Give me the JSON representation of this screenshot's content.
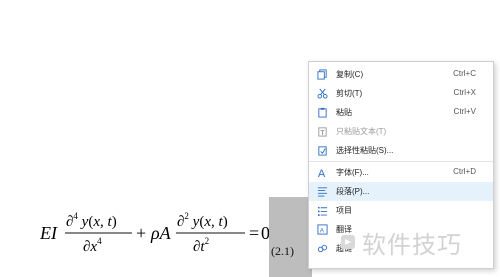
{
  "equation": {
    "lhs_text": "EI ∂⁴y(x,t)/∂x⁴ + ρA ∂²y(x,t)/∂t² = 0",
    "number": "(2.1)"
  },
  "context_menu": {
    "items": [
      {
        "label": "复制(C)",
        "shortcut": "Ctrl+C",
        "icon": "copy-icon",
        "enabled": true
      },
      {
        "label": "剪切(T)",
        "shortcut": "Ctrl+X",
        "icon": "cut-icon",
        "enabled": true
      },
      {
        "label": "粘贴",
        "shortcut": "Ctrl+V",
        "icon": "paste-icon",
        "enabled": true
      },
      {
        "label": "只粘贴文本(T)",
        "shortcut": "",
        "icon": "paste-text-icon",
        "enabled": false
      },
      {
        "label": "选择性粘贴(S)...",
        "shortcut": "",
        "icon": "paste-special-icon",
        "enabled": true
      },
      {
        "label": "字体(F)...",
        "shortcut": "Ctrl+D",
        "icon": "font-icon",
        "enabled": true
      },
      {
        "label": "段落(P)...",
        "shortcut": "",
        "icon": "paragraph-icon",
        "enabled": true
      },
      {
        "label": "项目",
        "shortcut": "",
        "icon": "list-icon",
        "enabled": true
      },
      {
        "label": "翻译",
        "shortcut": "",
        "icon": "translate-icon",
        "enabled": true
      },
      {
        "label": "超链",
        "shortcut": "",
        "icon": "hyperlink-icon",
        "enabled": true
      }
    ]
  },
  "watermark": {
    "text": "软件技巧"
  },
  "colors": {
    "hover": "#e5f1fb",
    "icon_blue": "#2f6fc6",
    "disabled": "#9a9a9a"
  }
}
